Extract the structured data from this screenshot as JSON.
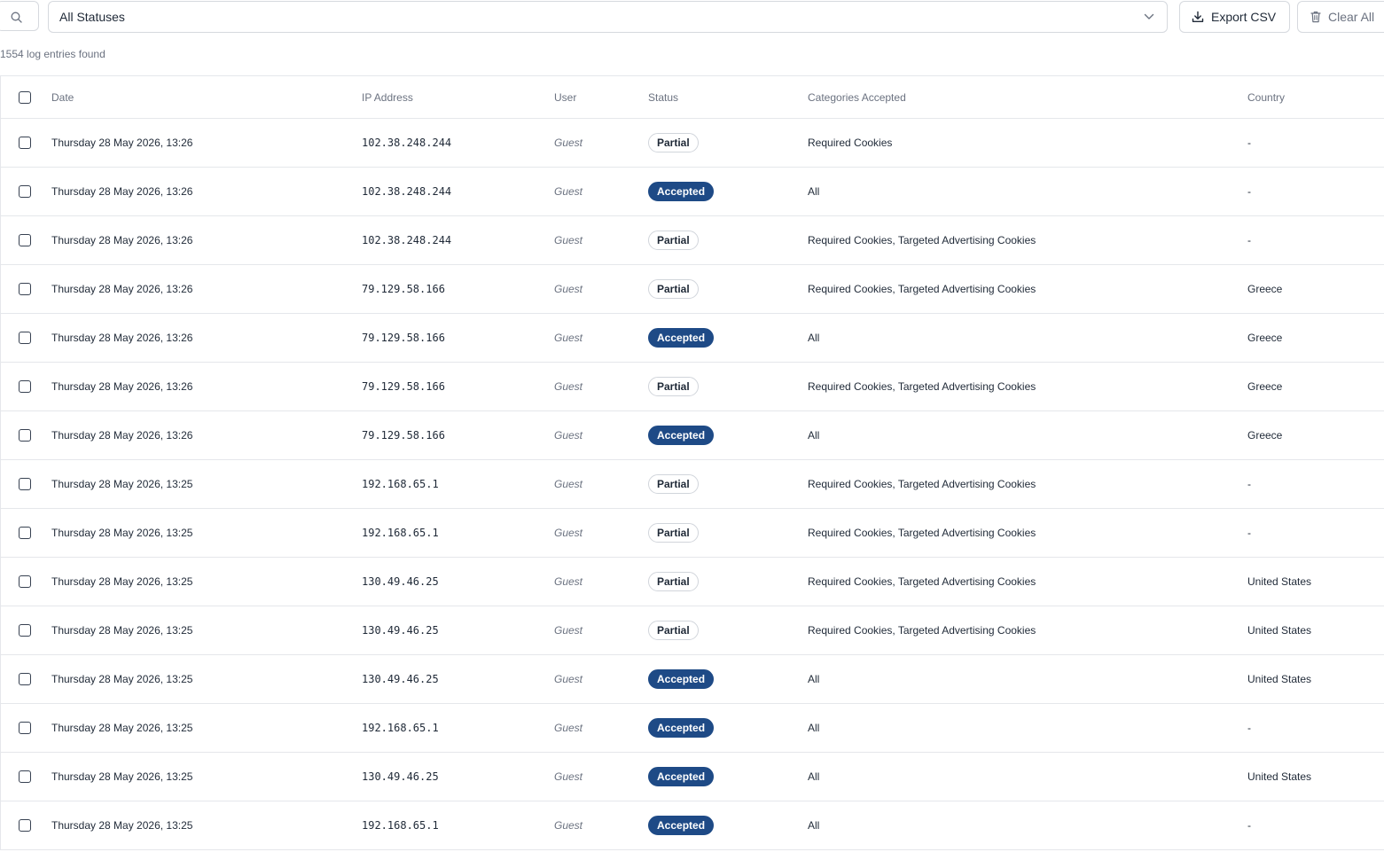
{
  "toolbar": {
    "status_filter_value": "All Statuses",
    "export_label": "Export CSV",
    "clear_label": "Clear All"
  },
  "summary": {
    "entry_count_text": "1554 log entries found"
  },
  "table": {
    "columns": [
      "Date",
      "IP Address",
      "User",
      "Status",
      "Categories Accepted",
      "Country"
    ],
    "rows": [
      {
        "date": "Thursday 28 May 2026, 13:26",
        "ip": "102.38.248.244",
        "user": "Guest",
        "status": "Partial",
        "categories": "Required Cookies",
        "country": "-"
      },
      {
        "date": "Thursday 28 May 2026, 13:26",
        "ip": "102.38.248.244",
        "user": "Guest",
        "status": "Accepted",
        "categories": "All",
        "country": "-"
      },
      {
        "date": "Thursday 28 May 2026, 13:26",
        "ip": "102.38.248.244",
        "user": "Guest",
        "status": "Partial",
        "categories": "Required Cookies, Targeted Advertising Cookies",
        "country": "-"
      },
      {
        "date": "Thursday 28 May 2026, 13:26",
        "ip": "79.129.58.166",
        "user": "Guest",
        "status": "Partial",
        "categories": "Required Cookies, Targeted Advertising Cookies",
        "country": "Greece"
      },
      {
        "date": "Thursday 28 May 2026, 13:26",
        "ip": "79.129.58.166",
        "user": "Guest",
        "status": "Accepted",
        "categories": "All",
        "country": "Greece"
      },
      {
        "date": "Thursday 28 May 2026, 13:26",
        "ip": "79.129.58.166",
        "user": "Guest",
        "status": "Partial",
        "categories": "Required Cookies, Targeted Advertising Cookies",
        "country": "Greece"
      },
      {
        "date": "Thursday 28 May 2026, 13:26",
        "ip": "79.129.58.166",
        "user": "Guest",
        "status": "Accepted",
        "categories": "All",
        "country": "Greece"
      },
      {
        "date": "Thursday 28 May 2026, 13:25",
        "ip": "192.168.65.1",
        "user": "Guest",
        "status": "Partial",
        "categories": "Required Cookies, Targeted Advertising Cookies",
        "country": "-"
      },
      {
        "date": "Thursday 28 May 2026, 13:25",
        "ip": "192.168.65.1",
        "user": "Guest",
        "status": "Partial",
        "categories": "Required Cookies, Targeted Advertising Cookies",
        "country": "-"
      },
      {
        "date": "Thursday 28 May 2026, 13:25",
        "ip": "130.49.46.25",
        "user": "Guest",
        "status": "Partial",
        "categories": "Required Cookies, Targeted Advertising Cookies",
        "country": "United States"
      },
      {
        "date": "Thursday 28 May 2026, 13:25",
        "ip": "130.49.46.25",
        "user": "Guest",
        "status": "Partial",
        "categories": "Required Cookies, Targeted Advertising Cookies",
        "country": "United States"
      },
      {
        "date": "Thursday 28 May 2026, 13:25",
        "ip": "130.49.46.25",
        "user": "Guest",
        "status": "Accepted",
        "categories": "All",
        "country": "United States"
      },
      {
        "date": "Thursday 28 May 2026, 13:25",
        "ip": "192.168.65.1",
        "user": "Guest",
        "status": "Accepted",
        "categories": "All",
        "country": "-"
      },
      {
        "date": "Thursday 28 May 2026, 13:25",
        "ip": "130.49.46.25",
        "user": "Guest",
        "status": "Accepted",
        "categories": "All",
        "country": "United States"
      },
      {
        "date": "Thursday 28 May 2026, 13:25",
        "ip": "192.168.65.1",
        "user": "Guest",
        "status": "Accepted",
        "categories": "All",
        "country": "-"
      }
    ]
  },
  "colors": {
    "accepted_badge": "#1e4a86",
    "border": "#e5e7eb",
    "muted_text": "#6b7280"
  },
  "icons": {
    "search": "search-icon",
    "dropdown": "chevron-down-icon",
    "export": "download-icon",
    "clear": "trash-icon"
  }
}
